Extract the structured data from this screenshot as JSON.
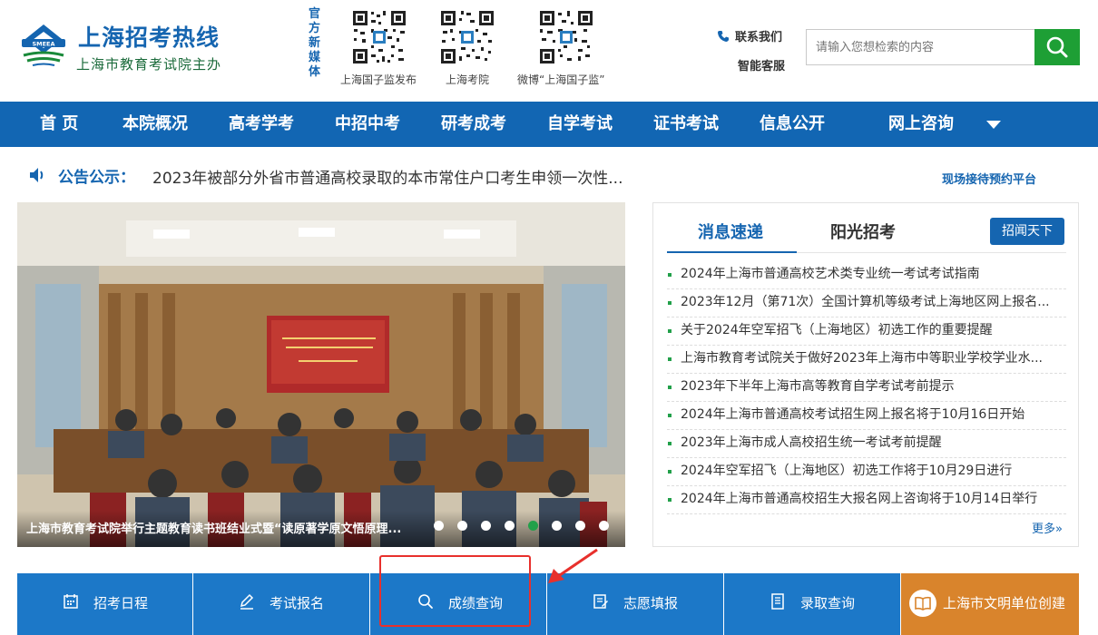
{
  "header": {
    "site_title": "上海招考热线",
    "site_subtitle": "上海市教育考试院主办",
    "logo_text": "SMEEA",
    "media_label": "官方新媒体",
    "qr_codes": [
      {
        "caption": "上海国子监发布"
      },
      {
        "caption": "上海考院"
      },
      {
        "caption": "微博“上海国子监”"
      }
    ],
    "contact": "联系我们",
    "service": "智能客服",
    "search_placeholder": "请输入您想检索的内容"
  },
  "nav": {
    "items": [
      "首 页",
      "本院概况",
      "高考学考",
      "中招中考",
      "研考成考",
      "自学考试",
      "证书考试",
      "信息公开",
      "网上咨询"
    ]
  },
  "notice": {
    "label": "公告公示：",
    "text": "2023年被部分外省市普通高校录取的本市常住户口考生申领一次性...",
    "appointment_link": "现场接待预约平台"
  },
  "slider": {
    "caption": "上海市教育考试院举行主题教育读书班结业式暨“读原著学原文悟原理...",
    "dot_count": 8,
    "active_dot": 4
  },
  "news": {
    "tabs": [
      "消息速递",
      "阳光招考"
    ],
    "active_tab": 0,
    "button": "招闻天下",
    "items": [
      "2024年上海市普通高校艺术类专业统一考试考试指南",
      "2023年12月（第71次）全国计算机等级考试上海地区网上报名...",
      "关于2024年空军招飞（上海地区）初选工作的重要提醒",
      "上海市教育考试院关于做好2023年上海市中等职业学校学业水...",
      "2023年下半年上海市高等教育自学考试考前提示",
      "2024年上海市普通高校考试招生网上报名将于10月16日开始",
      "2023年上海市成人高校招生统一考试考前提醒",
      "2024年空军招飞（上海地区）初选工作将于10月29日进行",
      "2024年上海市普通高校招生大报名网上咨询将于10月14日举行"
    ],
    "more": "更多»"
  },
  "quick_links": {
    "schedule": "招考日程",
    "register": "考试报名",
    "score": "成绩查询",
    "volunteer": "志愿填报",
    "admission": "录取查询",
    "civilization": "上海市文明单位创建"
  },
  "colors": {
    "primary_blue": "#1266b3",
    "green": "#1e9f35",
    "orange": "#d9842c",
    "highlight_red": "#e8302c"
  }
}
